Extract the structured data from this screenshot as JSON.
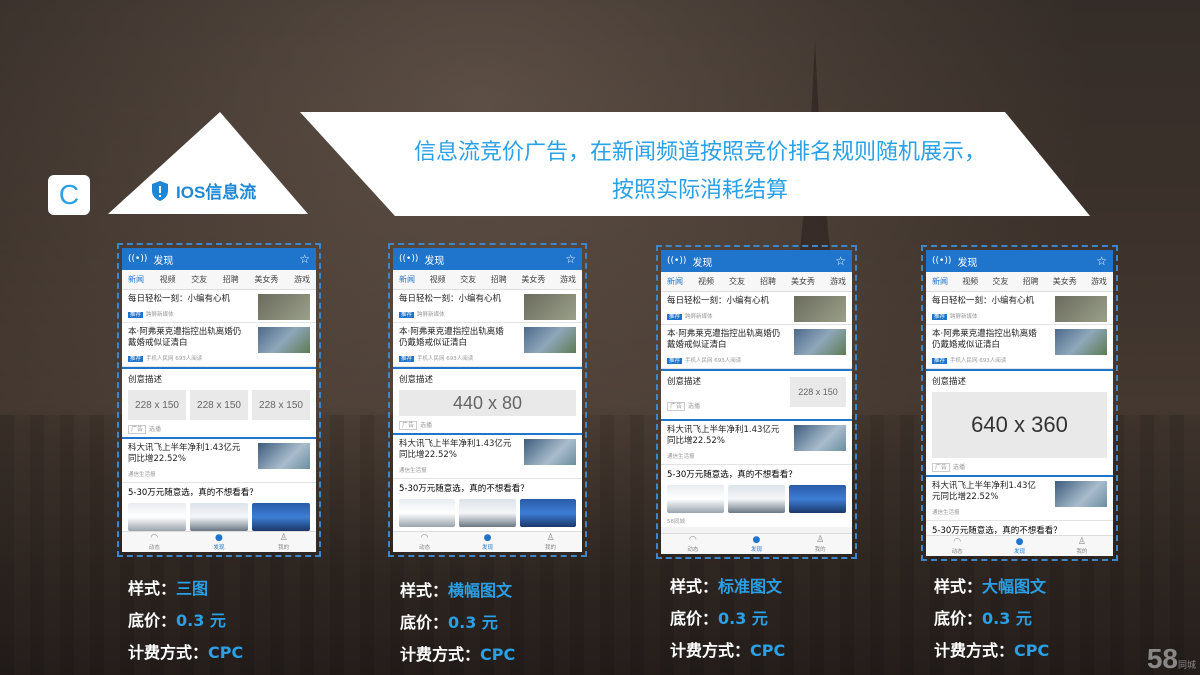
{
  "badge": "C",
  "section_label": "IOS信息流",
  "banner_text": "信息流竞价广告，在新闻频道按照竞价排名规则随机展示，按照实际消耗结算",
  "phone": {
    "title": "发现",
    "tabs": [
      "新闻",
      "视频",
      "交友",
      "招聘",
      "美女秀",
      "游戏"
    ],
    "news1": "每日轻松一刻：小编有心机",
    "news1_meta": "跨屏新媒体",
    "news2": "本·阿弗莱克遭指控出轨离婚仍戴婚戒似证清白",
    "news2_meta": "手机人民网  693人阅读",
    "ad_label": "创意描述",
    "ad_foot": "选播",
    "news3": "科大讯飞上半年净利1.43亿元同比增22.52%",
    "news3_meta": "通信生活报",
    "news4": "5-30万元随意选，真的不想看看？",
    "news4_meta": "58同城",
    "nav": [
      "动态",
      "发现",
      "我的"
    ]
  },
  "ad_sizes": {
    "three": [
      "228 x 150",
      "228 x 150",
      "228 x 150"
    ],
    "banner": "440 x 80",
    "standard": "228 x 150",
    "large": "640 x 360"
  },
  "captions": [
    {
      "style_label": "样式：",
      "style": "三图",
      "price_label": "底价：",
      "price": "0.3 元",
      "billing_label": "计费方式：",
      "billing": "CPC"
    },
    {
      "style_label": "样式：",
      "style": "横幅图文",
      "price_label": "底价：",
      "price": "0.3 元",
      "billing_label": "计费方式：",
      "billing": "CPC"
    },
    {
      "style_label": "样式：",
      "style": "标准图文",
      "price_label": "底价：",
      "price": "0.3 元",
      "billing_label": "计费方式：",
      "billing": "CPC"
    },
    {
      "style_label": "样式：",
      "style": "大幅图文",
      "price_label": "底价：",
      "price": "0.3 元",
      "billing_label": "计费方式：",
      "billing": "CPC"
    }
  ],
  "brand": {
    "name": "58",
    "sub": "同城"
  }
}
